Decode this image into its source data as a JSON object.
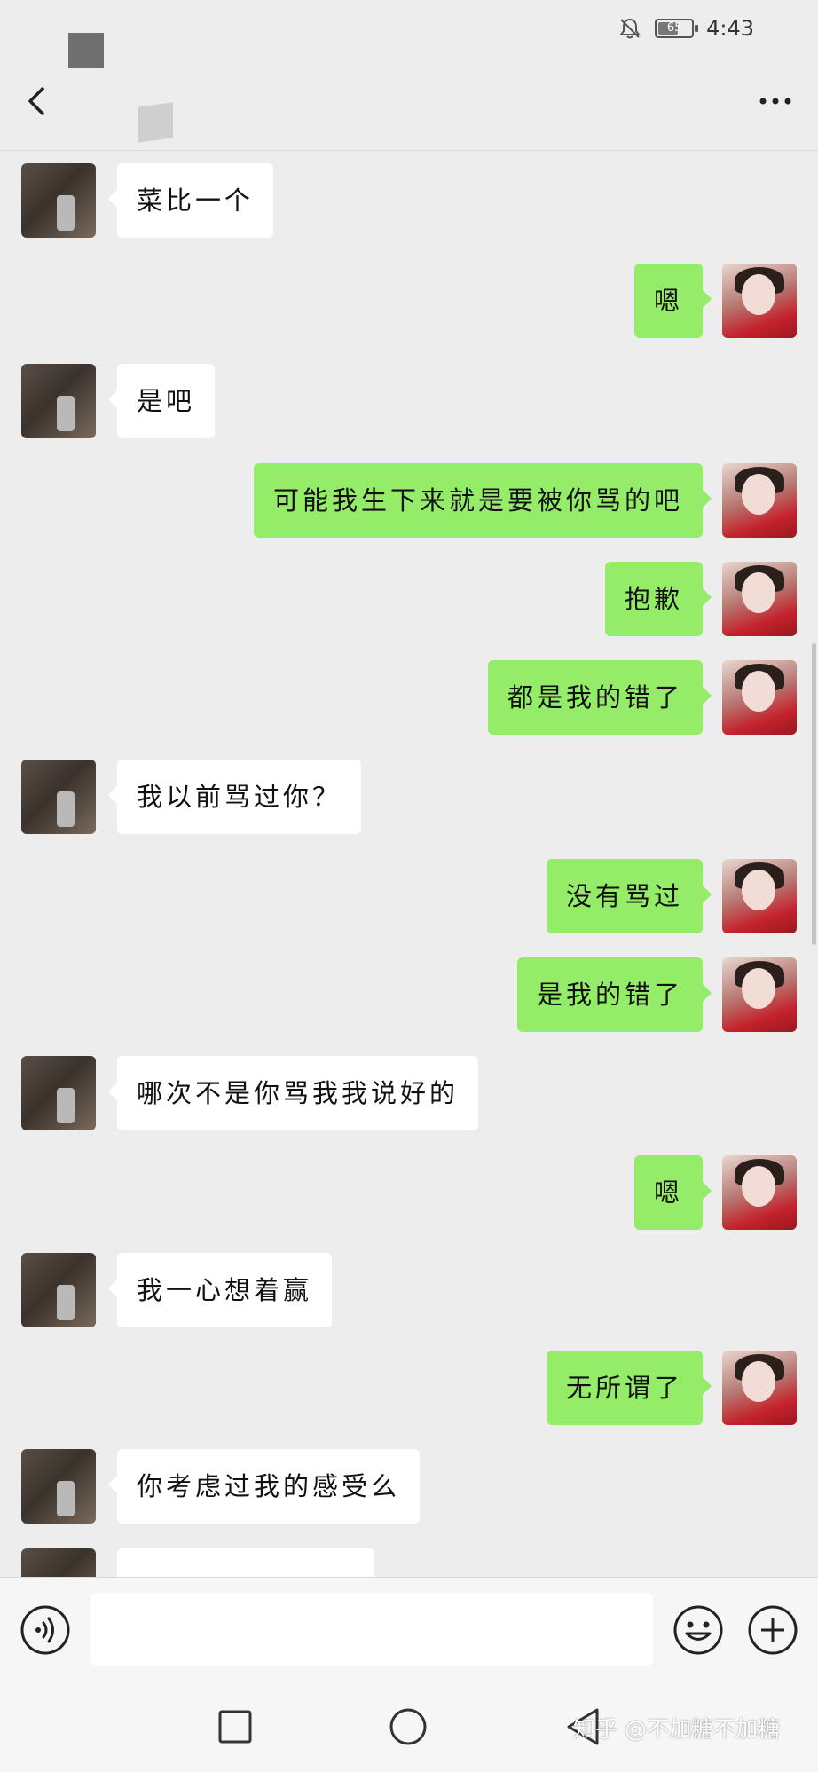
{
  "status_bar": {
    "time": "4:43",
    "battery_level": "65",
    "icons": [
      "bell-off-icon",
      "battery-icon"
    ]
  },
  "header": {
    "back_icon": "chevron-left-icon",
    "more_icon": "more-dots-icon"
  },
  "messages": [
    {
      "side": "peer",
      "text": "菜比一个"
    },
    {
      "side": "self",
      "text": "嗯"
    },
    {
      "side": "peer",
      "text": "是吧"
    },
    {
      "side": "self",
      "text": "可能我生下来就是要被你骂的吧"
    },
    {
      "side": "self",
      "text": "抱歉"
    },
    {
      "side": "self",
      "text": "都是我的错了"
    },
    {
      "side": "peer",
      "text": "我以前骂过你？"
    },
    {
      "side": "self",
      "text": "没有骂过"
    },
    {
      "side": "self",
      "text": "是我的错了"
    },
    {
      "side": "peer",
      "text": "哪次不是你骂我我说好的"
    },
    {
      "side": "self",
      "text": "嗯"
    },
    {
      "side": "peer",
      "text": "我一心想着赢"
    },
    {
      "side": "self",
      "text": "无所谓了"
    },
    {
      "side": "peer",
      "text": "你考虑过我的感受么"
    },
    {
      "side": "peer",
      "text": ""
    }
  ],
  "input_bar": {
    "value": "",
    "icons": [
      "voice-icon",
      "emoji-icon",
      "plus-icon"
    ]
  },
  "nav_bar": {
    "icons": [
      "nav-square-icon",
      "nav-circle-icon",
      "nav-back-icon"
    ],
    "watermark": "知乎 @不加糖不加糖"
  },
  "colors": {
    "background": "#ededed",
    "self_bubble": "#95ec69",
    "peer_bubble": "#ffffff"
  }
}
